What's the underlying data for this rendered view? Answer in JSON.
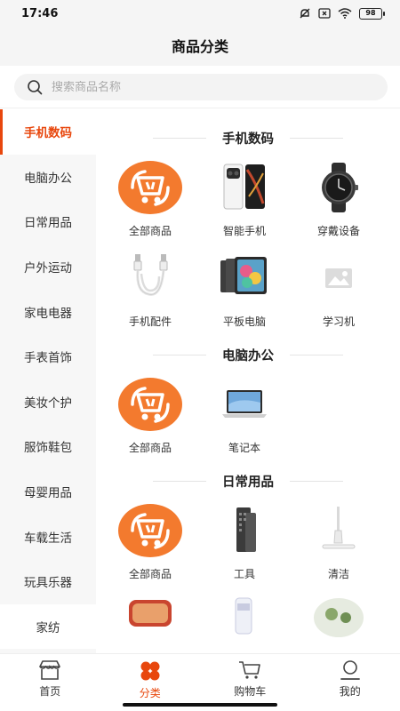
{
  "status": {
    "time": "17:46",
    "battery": "98"
  },
  "header": {
    "title": "商品分类"
  },
  "search": {
    "placeholder": "搜索商品名称"
  },
  "sidebar": {
    "items": [
      {
        "label": "手机数码",
        "active": true
      },
      {
        "label": "电脑办公"
      },
      {
        "label": "日常用品"
      },
      {
        "label": "户外运动"
      },
      {
        "label": "家电电器"
      },
      {
        "label": "手表首饰"
      },
      {
        "label": "美妆个护"
      },
      {
        "label": "服饰鞋包"
      },
      {
        "label": "母婴用品"
      },
      {
        "label": "车载生活"
      },
      {
        "label": "玩具乐器"
      },
      {
        "label": "家纺"
      }
    ]
  },
  "sections": [
    {
      "title": "手机数码",
      "items": [
        {
          "label": "全部商品",
          "icon": "all-goods-icon"
        },
        {
          "label": "智能手机",
          "icon": "smartphone-icon"
        },
        {
          "label": "穿戴设备",
          "icon": "smartwatch-icon"
        },
        {
          "label": "手机配件",
          "icon": "usb-cable-icon"
        },
        {
          "label": "平板电脑",
          "icon": "tablet-icon"
        },
        {
          "label": "学习机",
          "icon": "image-placeholder-icon"
        }
      ]
    },
    {
      "title": "电脑办公",
      "items": [
        {
          "label": "全部商品",
          "icon": "all-goods-icon"
        },
        {
          "label": "笔记本",
          "icon": "laptop-icon"
        }
      ]
    },
    {
      "title": "日常用品",
      "items": [
        {
          "label": "全部商品",
          "icon": "all-goods-icon"
        },
        {
          "label": "工具",
          "icon": "tool-icon"
        },
        {
          "label": "清洁",
          "icon": "mop-icon"
        }
      ]
    }
  ],
  "nav": {
    "items": [
      {
        "label": "首页",
        "icon": "store-icon"
      },
      {
        "label": "分类",
        "icon": "category-icon",
        "active": true
      },
      {
        "label": "购物车",
        "icon": "cart-icon"
      },
      {
        "label": "我的",
        "icon": "user-icon"
      }
    ]
  },
  "colors": {
    "accent": "#e8470d",
    "sidebar_bg": "#f7f7f7"
  }
}
